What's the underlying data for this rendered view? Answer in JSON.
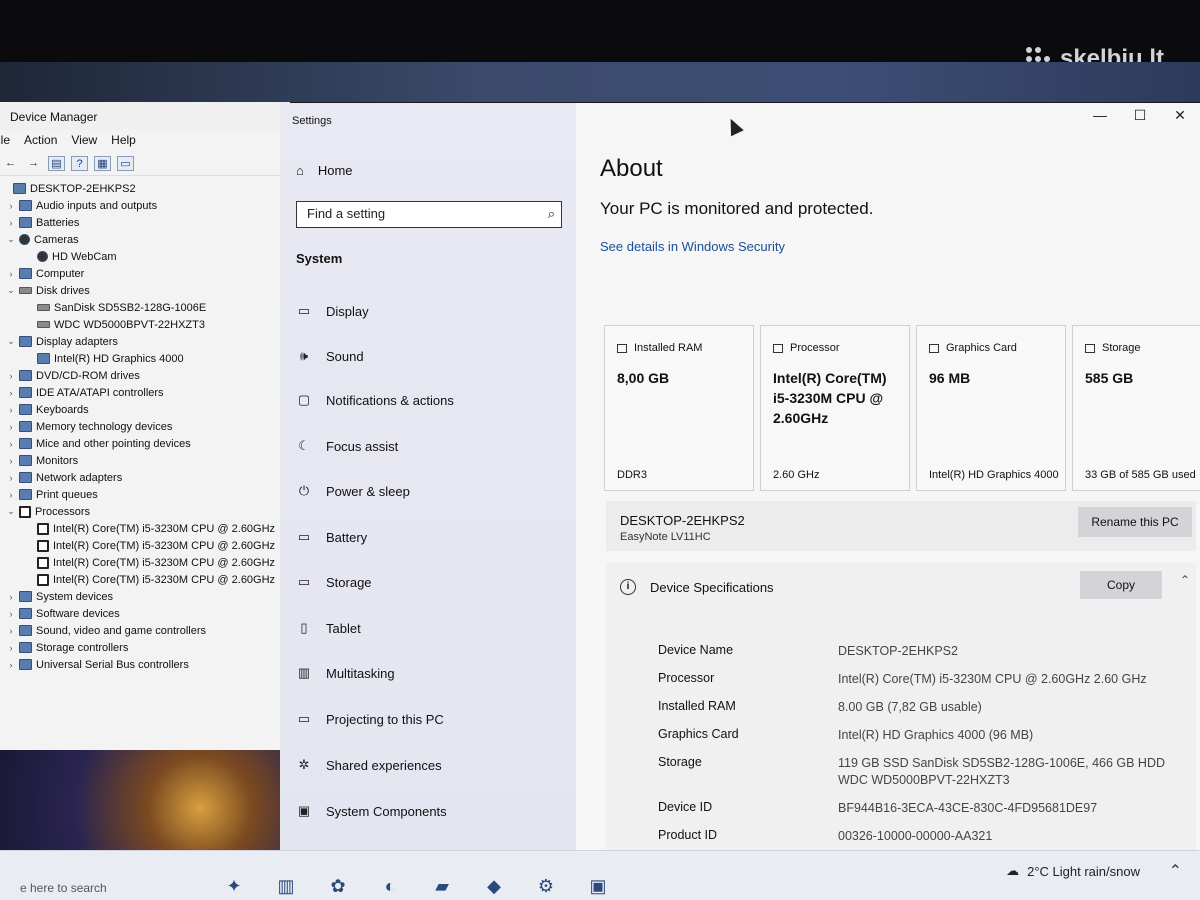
{
  "watermark": "skelbiu.lt",
  "device_manager": {
    "title": "Device Manager",
    "menu": [
      "ile",
      "Action",
      "View",
      "Help"
    ],
    "tree": [
      {
        "label": "DESKTOP-2EHKPS2",
        "level": 0,
        "icon": "computer-icon",
        "expander": ""
      },
      {
        "label": "Audio inputs and outputs",
        "level": 1,
        "icon": "speaker-icon",
        "expander": "›"
      },
      {
        "label": "Batteries",
        "level": 1,
        "icon": "battery-icon",
        "expander": "›"
      },
      {
        "label": "Cameras",
        "level": 1,
        "icon": "camera-icon",
        "expander": "⌄"
      },
      {
        "label": "HD WebCam",
        "level": 2,
        "icon": "camera-icon",
        "expander": ""
      },
      {
        "label": "Computer",
        "level": 1,
        "icon": "computer-icon",
        "expander": "›"
      },
      {
        "label": "Disk drives",
        "level": 1,
        "icon": "disk-icon",
        "expander": "⌄"
      },
      {
        "label": "SanDisk SD5SB2-128G-1006E",
        "level": 2,
        "icon": "disk-icon",
        "expander": ""
      },
      {
        "label": "WDC WD5000BPVT-22HXZT3",
        "level": 2,
        "icon": "disk-icon",
        "expander": ""
      },
      {
        "label": "Display adapters",
        "level": 1,
        "icon": "monitor-icon",
        "expander": "⌄"
      },
      {
        "label": "Intel(R) HD Graphics 4000",
        "level": 2,
        "icon": "monitor-icon",
        "expander": ""
      },
      {
        "label": "DVD/CD-ROM drives",
        "level": 1,
        "icon": "dvd-icon",
        "expander": "›"
      },
      {
        "label": "IDE ATA/ATAPI controllers",
        "level": 1,
        "icon": "controller-icon",
        "expander": "›"
      },
      {
        "label": "Keyboards",
        "level": 1,
        "icon": "keyboard-icon",
        "expander": "›"
      },
      {
        "label": "Memory technology devices",
        "level": 1,
        "icon": "memory-icon",
        "expander": "›"
      },
      {
        "label": "Mice and other pointing devices",
        "level": 1,
        "icon": "mouse-icon",
        "expander": "›"
      },
      {
        "label": "Monitors",
        "level": 1,
        "icon": "monitor-icon",
        "expander": "›"
      },
      {
        "label": "Network adapters",
        "level": 1,
        "icon": "network-icon",
        "expander": "›"
      },
      {
        "label": "Print queues",
        "level": 1,
        "icon": "printer-icon",
        "expander": "›"
      },
      {
        "label": "Processors",
        "level": 1,
        "icon": "cpu-icon",
        "expander": "⌄"
      },
      {
        "label": "Intel(R) Core(TM) i5-3230M CPU @ 2.60GHz",
        "level": 2,
        "icon": "cpu-icon",
        "expander": ""
      },
      {
        "label": "Intel(R) Core(TM) i5-3230M CPU @ 2.60GHz",
        "level": 2,
        "icon": "cpu-icon",
        "expander": ""
      },
      {
        "label": "Intel(R) Core(TM) i5-3230M CPU @ 2.60GHz",
        "level": 2,
        "icon": "cpu-icon",
        "expander": ""
      },
      {
        "label": "Intel(R) Core(TM) i5-3230M CPU @ 2.60GHz",
        "level": 2,
        "icon": "cpu-icon",
        "expander": ""
      },
      {
        "label": "System devices",
        "level": 1,
        "icon": "system-icon",
        "expander": "›"
      },
      {
        "label": "Software devices",
        "level": 1,
        "icon": "software-icon",
        "expander": "›"
      },
      {
        "label": "Sound, video and game controllers",
        "level": 1,
        "icon": "sound-icon",
        "expander": "›"
      },
      {
        "label": "Storage controllers",
        "level": 1,
        "icon": "storage-icon",
        "expander": "›"
      },
      {
        "label": "Universal Serial Bus controllers",
        "level": 1,
        "icon": "usb-icon",
        "expander": "›"
      }
    ]
  },
  "settings": {
    "window_title": "Settings",
    "home_label": "Home",
    "search_placeholder": "Find a setting",
    "section_label": "System",
    "nav_items": [
      {
        "label": "Display",
        "icon": "display-icon",
        "glyph": "▭"
      },
      {
        "label": "Sound",
        "icon": "sound-icon",
        "glyph": "🕪"
      },
      {
        "label": "Notifications & actions",
        "icon": "notification-icon",
        "glyph": "▢"
      },
      {
        "label": "Focus assist",
        "icon": "moon-icon",
        "glyph": "☾"
      },
      {
        "label": "Power & sleep",
        "icon": "power-icon",
        "glyph": "⏻"
      },
      {
        "label": "Battery",
        "icon": "battery-icon",
        "glyph": "▭"
      },
      {
        "label": "Storage",
        "icon": "storage-icon",
        "glyph": "▭"
      },
      {
        "label": "Tablet",
        "icon": "tablet-icon",
        "glyph": "▯"
      },
      {
        "label": "Multitasking",
        "icon": "multitasking-icon",
        "glyph": "▥"
      },
      {
        "label": "Projecting to this PC",
        "icon": "projecting-icon",
        "glyph": "▭"
      },
      {
        "label": "Shared experiences",
        "icon": "shared-icon",
        "glyph": "✲"
      },
      {
        "label": "System Components",
        "icon": "components-icon",
        "glyph": "▣"
      }
    ],
    "about": {
      "title": "About",
      "monitored": "Your PC is monitored and protected.",
      "security_link": "See details in Windows Security"
    },
    "cards": [
      {
        "title": "Installed RAM",
        "value": "8,00 GB",
        "footer": "DDR3",
        "icon": "ram-icon"
      },
      {
        "title": "Processor",
        "value": "Intel(R) Core(TM) i5-3230M CPU @ 2.60GHz",
        "footer": "2.60 GHz",
        "icon": "processor-icon"
      },
      {
        "title": "Graphics Card",
        "value": "96 MB",
        "footer": "Intel(R) HD Graphics 4000",
        "icon": "graphics-icon"
      },
      {
        "title": "Storage",
        "value": "585 GB",
        "footer": "33 GB of 585 GB used",
        "icon": "storage-icon"
      }
    ],
    "pc": {
      "name": "DESKTOP-2EHKPS2",
      "model": "EasyNote LV11HC",
      "rename_label": "Rename this PC"
    },
    "specs": {
      "title": "Device Specifications",
      "copy_label": "Copy",
      "rows": [
        {
          "key": "Device Name",
          "value": "DESKTOP-2EHKPS2"
        },
        {
          "key": "Processor",
          "value": "Intel(R) Core(TM) i5-3230M CPU @ 2.60GHz   2.60 GHz"
        },
        {
          "key": "Installed RAM",
          "value": "8.00 GB (7,82 GB usable)"
        },
        {
          "key": "Graphics Card",
          "value": "Intel(R) HD Graphics 4000 (96 MB)"
        },
        {
          "key": "Storage",
          "value": "119 GB SSD SanDisk SD5SB2-128G-1006E, 466 GB HDD WDC WD5000BPVT-22HXZT3"
        },
        {
          "key": "Device ID",
          "value": "BF944B16-3ECA-43CE-830C-4FD95681DE97"
        },
        {
          "key": "Product ID",
          "value": "00326-10000-00000-AA321"
        }
      ]
    }
  },
  "taskbar": {
    "search_text": "e here to search",
    "weather": "2°C  Light rain/snow"
  }
}
